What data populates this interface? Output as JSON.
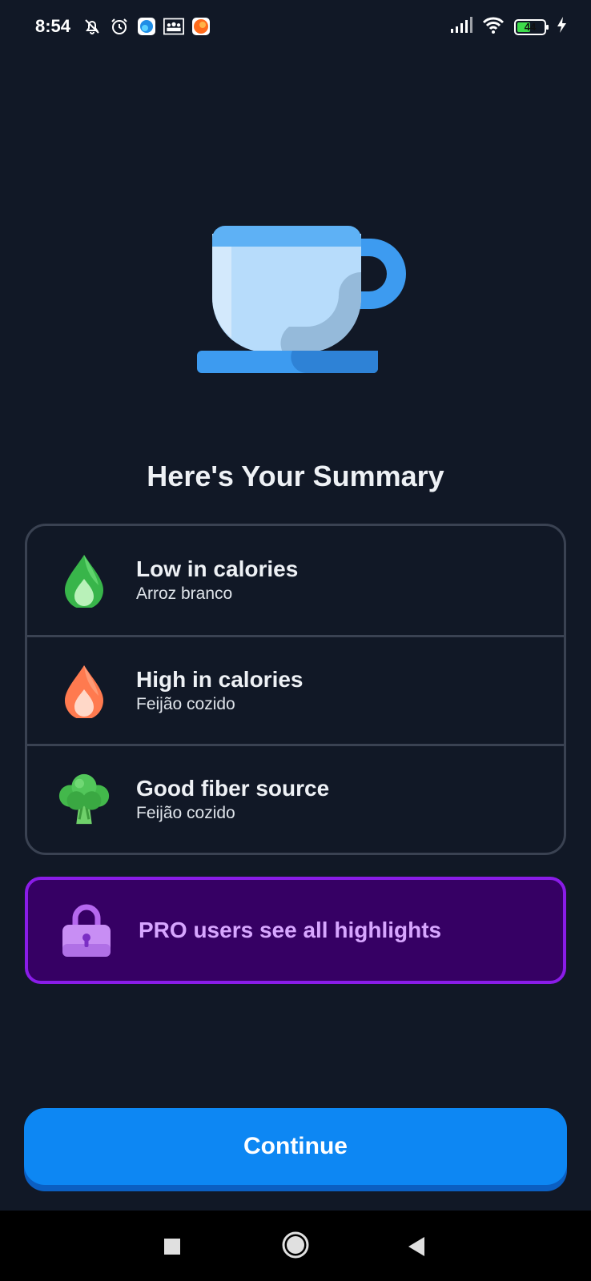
{
  "status_bar": {
    "time": "8:54",
    "battery_level": "44",
    "icons_left": [
      "mute-bell-icon",
      "alarm-icon",
      "app-icon-blue",
      "app-icon-group",
      "app-icon-orange"
    ],
    "icons_right": [
      "signal-icon",
      "wifi-icon",
      "battery-icon",
      "charging-icon"
    ]
  },
  "hero": {
    "icon": "coffee-cup-illustration"
  },
  "summary": {
    "title": "Here's Your Summary",
    "items": [
      {
        "icon": "green-drop-icon",
        "title": "Low in calories",
        "subtitle": "Arroz branco"
      },
      {
        "icon": "orange-flame-icon",
        "title": "High in calories",
        "subtitle": "Feijão cozido"
      },
      {
        "icon": "broccoli-icon",
        "title": "Good fiber source",
        "subtitle": "Feijão cozido"
      }
    ]
  },
  "pro_banner": {
    "icon": "lock-icon",
    "text": "PRO users see all highlights"
  },
  "continue_button": {
    "label": "Continue"
  },
  "nav_bar": {
    "buttons": [
      "recents-button",
      "home-button",
      "back-button"
    ]
  },
  "colors": {
    "background": "#111826",
    "card_border": "#3a4252",
    "pro_background": "#360064",
    "pro_border": "#8a1ce8",
    "pro_text": "#d7a6ff",
    "button": "#0d87f3"
  }
}
